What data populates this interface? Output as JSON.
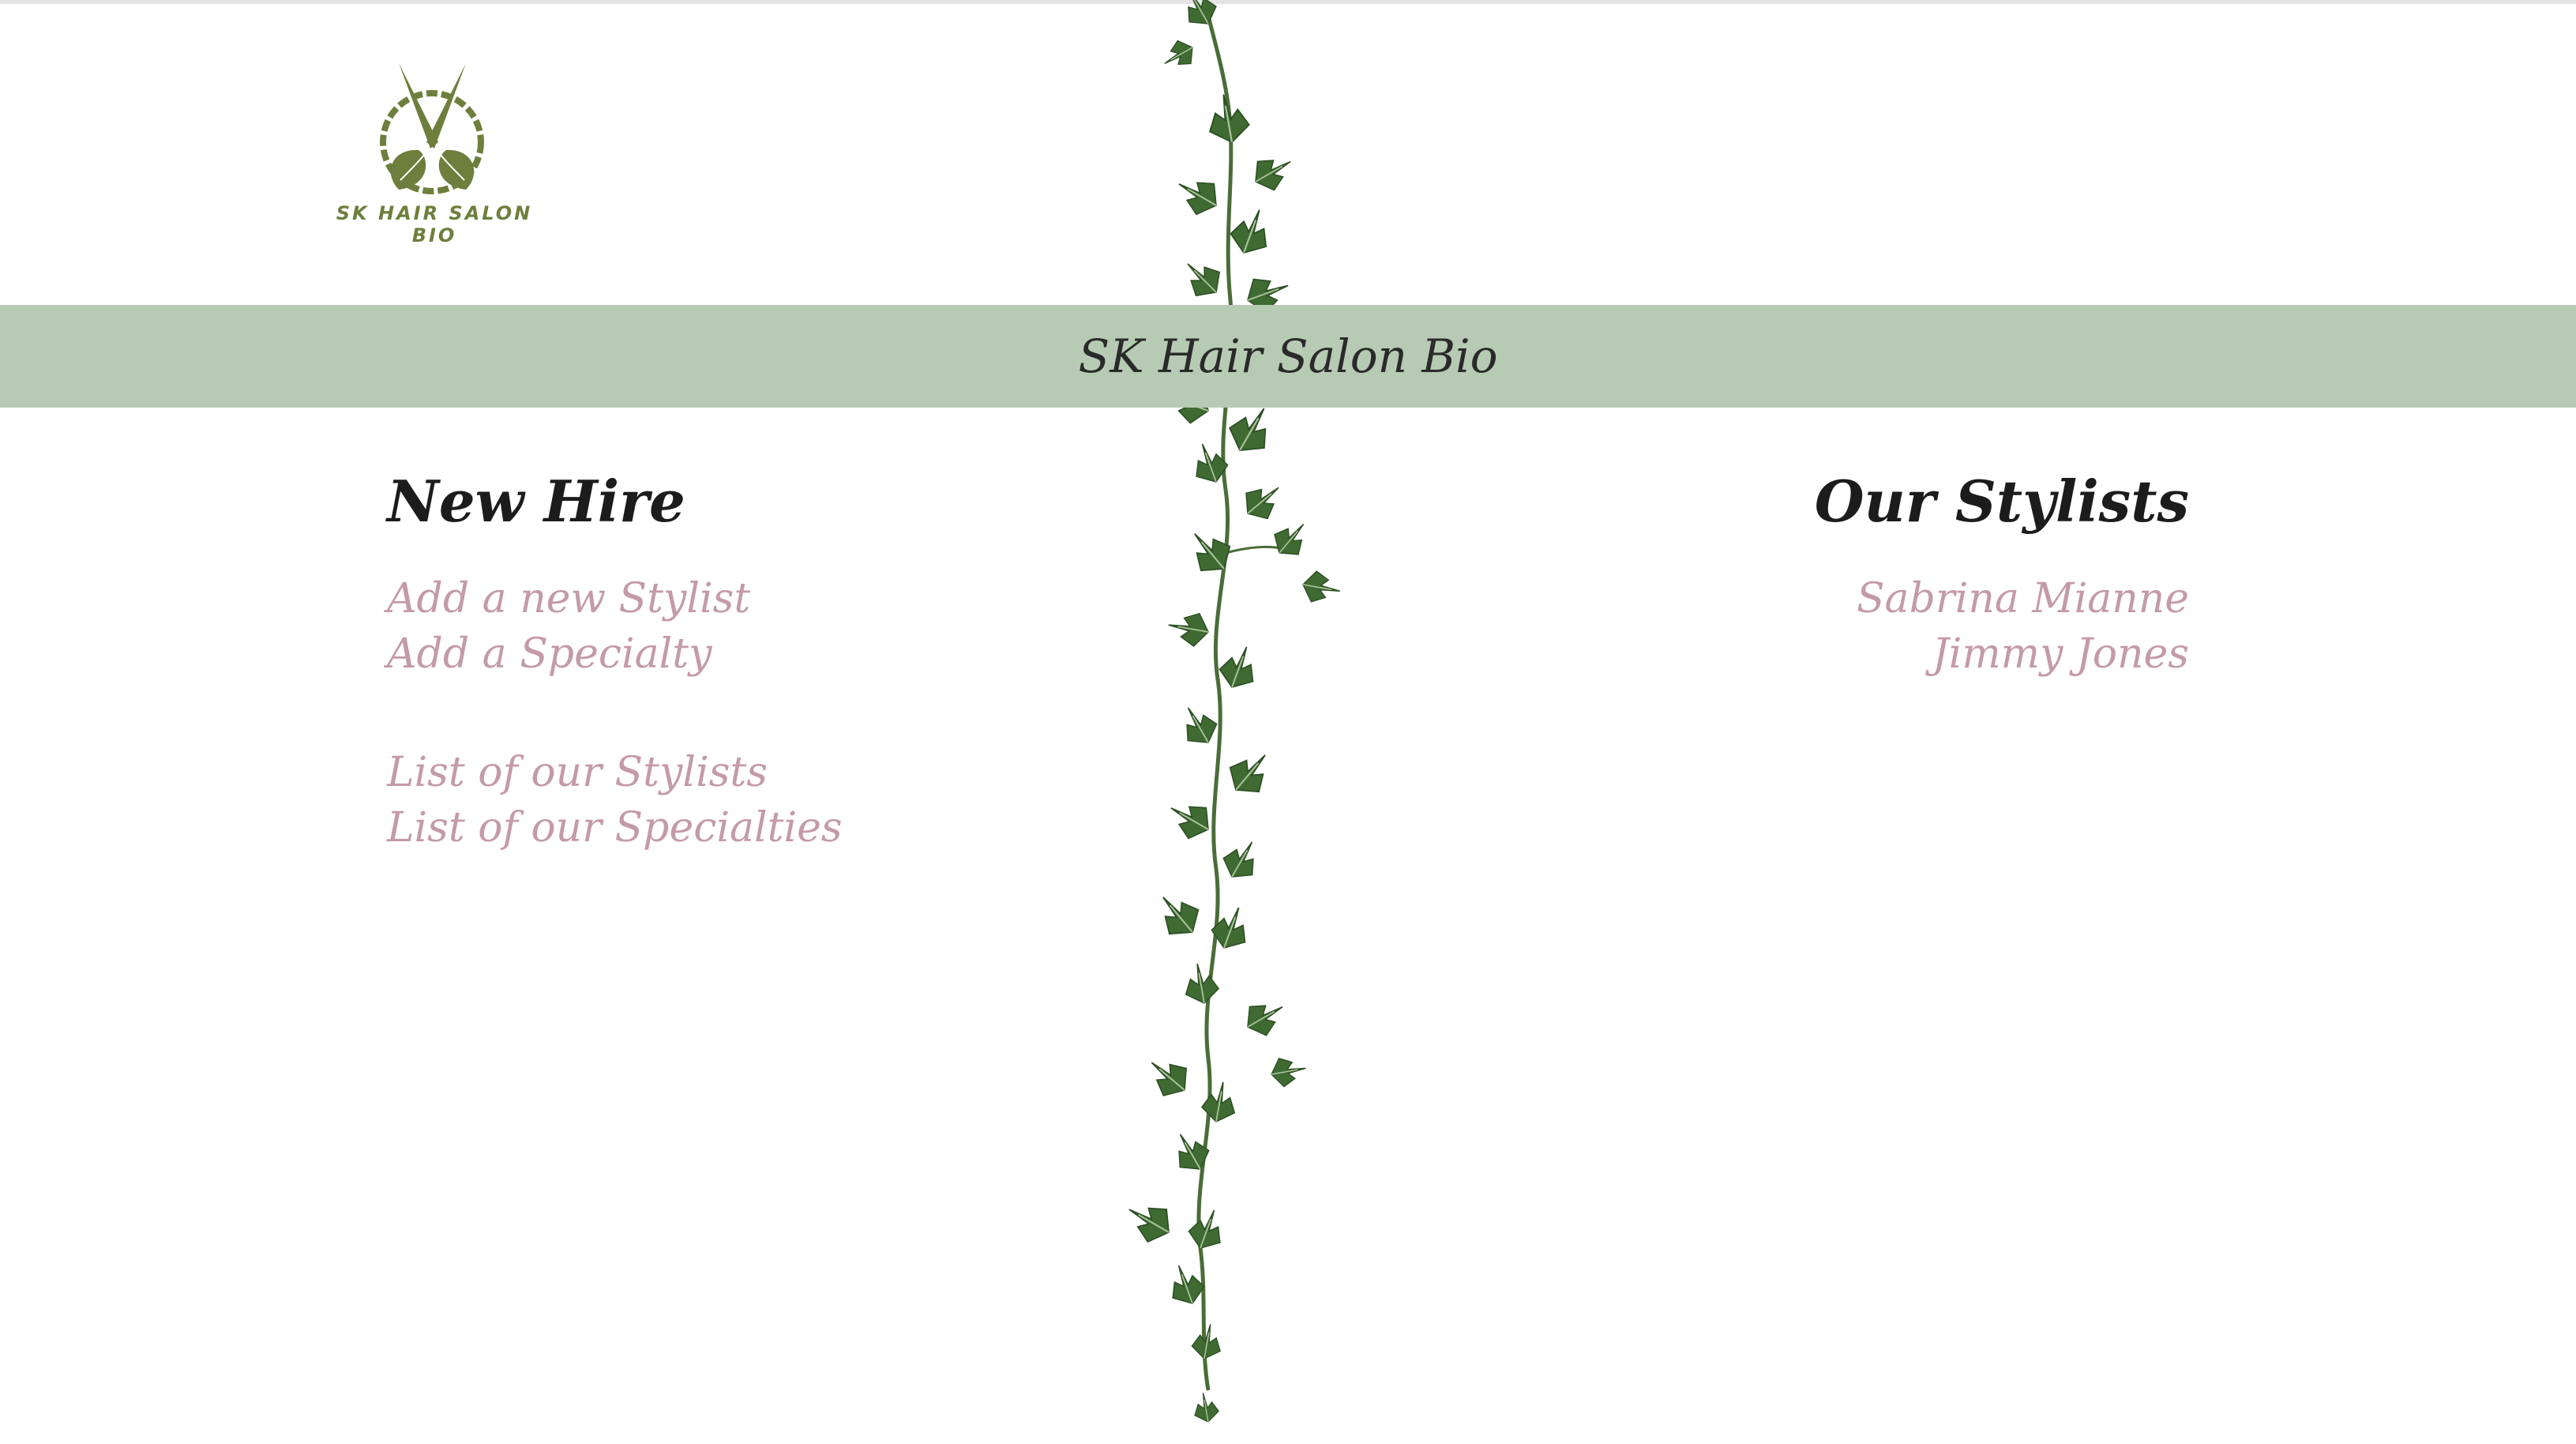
{
  "logo": {
    "text": "SK HAIR SALON BIO",
    "icon": "scissors-leaf-logo",
    "color": "#6d7f3c"
  },
  "banner": {
    "title": "SK Hair Salon Bio",
    "color": "#b7cbb4"
  },
  "new_hire": {
    "heading": "New Hire",
    "links": [
      {
        "label": "Add a new Stylist"
      },
      {
        "label": "Add a Specialty"
      }
    ],
    "list_links": [
      {
        "label": "List of our Stylists"
      },
      {
        "label": "List of our Specialties"
      }
    ]
  },
  "stylists": {
    "heading": "Our Stylists",
    "items": [
      {
        "label": "Sabrina Mianne"
      },
      {
        "label": "Jimmy Jones"
      }
    ]
  },
  "colors": {
    "link": "#c49aa9",
    "heading": "#1c1c1c",
    "vine": "#3f6b32"
  }
}
